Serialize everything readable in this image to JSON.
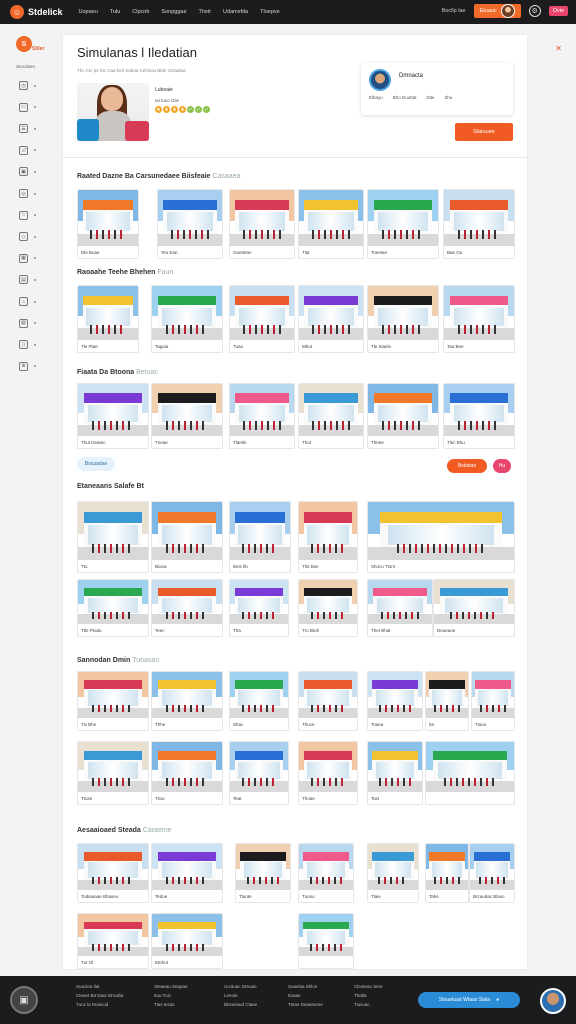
{
  "topbar": {
    "brand": "Stdelick",
    "nav": [
      "Uopaeu",
      "Tulu",
      "Clpcnb",
      "Sonpggae",
      "Thstr",
      "Udamsfda",
      "Tloepve"
    ],
    "link": "Bocllp lae",
    "cta": "Etuauc",
    "badge": "Ovie"
  },
  "sidebar": {
    "brand": "Stiler",
    "section": "Stocdaen",
    "items": [
      {
        "icon": "clock-icon",
        "glyph": "◷"
      },
      {
        "icon": "store-icon",
        "glyph": "▭"
      },
      {
        "icon": "list-icon",
        "glyph": "☰"
      },
      {
        "icon": "chart-icon",
        "glyph": "◿"
      },
      {
        "icon": "cart-icon",
        "glyph": "▣"
      },
      {
        "icon": "globe-icon",
        "glyph": "◎"
      },
      {
        "icon": "star-icon",
        "glyph": "☆"
      },
      {
        "icon": "tag-icon",
        "glyph": "◇"
      },
      {
        "icon": "grid-icon",
        "glyph": "▦"
      },
      {
        "icon": "calendar-icon",
        "glyph": "▤"
      },
      {
        "icon": "box-icon",
        "glyph": "⌂"
      },
      {
        "icon": "photo-icon",
        "glyph": "▧"
      },
      {
        "icon": "page-icon",
        "glyph": "▯"
      },
      {
        "icon": "world-icon",
        "glyph": "⊕"
      }
    ]
  },
  "hero": {
    "title": "Simulanas l Iledatian",
    "subtitle": "Thc Ctc pe btc Caa fonl Sabaa Cehlsou Blde Ovtaatsa",
    "meta_line1": "Lubeaie",
    "meta_line2": "Iai tuno Giie"
  },
  "profile": {
    "name": "Dmnacta",
    "info": [
      "Elbayu",
      "Bho Duuttat",
      "Dite",
      "Zhu"
    ],
    "apply": "Slatuuee"
  },
  "sections": [
    {
      "title": "Raated Dazne Ba Carsunedaee Biisfeaie",
      "hint": "Casaaea",
      "captions": [
        "Dle Buae",
        "Teo Ean",
        "Ooetetan",
        "Tlat",
        "Toeetan",
        "Bae Ou"
      ]
    },
    {
      "title": "Raoaahe Teehe Bhehen",
      "hint": "Faun",
      "captions": [
        "Tle Ptae",
        "Tagaia",
        "Tuao",
        "Mhut",
        "Tle Siaelo",
        "Taa Bee"
      ]
    },
    {
      "title": "Fiaata Da Btoona",
      "hint": "Betuac",
      "captions": [
        "Thut Deatec",
        "Tneae",
        "Tlaetle",
        "Thut",
        "Tlrnee",
        "Tlec Bhu"
      ]
    },
    {
      "title": "Etaneaans Salafe Bt",
      "hint": "",
      "captions": [
        "Ttu",
        "Bioea",
        "Beis Ilb",
        "Thit Bse",
        "Shocu Ttsnt",
        "Ttle Ptodu",
        "Teec",
        "Tha",
        "Tro Btuh",
        "Thet Bhat",
        "Deueaoe"
      ]
    },
    {
      "title": "Sannodan Dmin",
      "hint": "Tuoasan",
      "captions": [
        "Tiv Bhe",
        "Thhe",
        "Shac",
        "Thuce",
        "Toaea",
        "Ita",
        "Tiaou",
        "Ttuse",
        "Tirac",
        "Teat",
        "Thoae",
        "Tact"
      ]
    },
    {
      "title": "Aesaaioaed Steada",
      "hint": "Caraeme",
      "captions": [
        "Todiaaaae Bhaseu",
        "Tedue",
        "Tlaote",
        "Tuonu",
        "Tlaie",
        "Tahe",
        "Brcaudac Blaso",
        "Tut Ol",
        "Etehut"
      ]
    }
  ],
  "buttons": {
    "show_more": "Bocuadae",
    "view_all": "Betiatan",
    "pink": "Hu"
  },
  "footer": {
    "cols": [
      [
        "Suaclea tlat",
        "Cteaet Ba Daul Ishcalta",
        "Tunc la Rusecid"
      ],
      [
        "Steaeau Seqaae",
        "Ituu Tuic",
        "Tlas tesas"
      ],
      [
        "Ucotuac Dreuan",
        "Leeoie",
        "Bloneiaud Ctaee"
      ],
      [
        "Suaelaa Shlon",
        "Ituaae",
        "Tteae Deaatoene"
      ],
      [
        "Cleoteao Stne",
        "Thatla",
        "Tiusoac"
      ]
    ],
    "pill": "Stouetuad Wtaao Slala"
  },
  "colors": {
    "accent": "#f15a22",
    "dark": "#1c1c1e",
    "pink": "#e8456b",
    "blue": "#2a8cd6"
  }
}
